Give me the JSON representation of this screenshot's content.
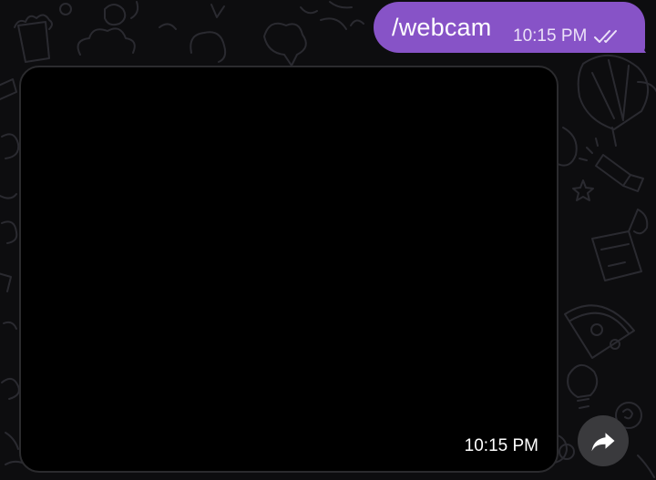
{
  "chat": {
    "outgoing_message": {
      "text": "/webcam",
      "time": "10:15 PM",
      "status_icon": "double-check-icon"
    },
    "media_message": {
      "time": "10:15 PM",
      "content": "black-video-frame"
    },
    "share_button": {
      "icon": "share-arrow-icon"
    }
  },
  "colors": {
    "background": "#0d0d0f",
    "outgoing_bubble": "#8753c7",
    "media_border": "#2b2b2e",
    "share_button": "#3a3a3d"
  }
}
